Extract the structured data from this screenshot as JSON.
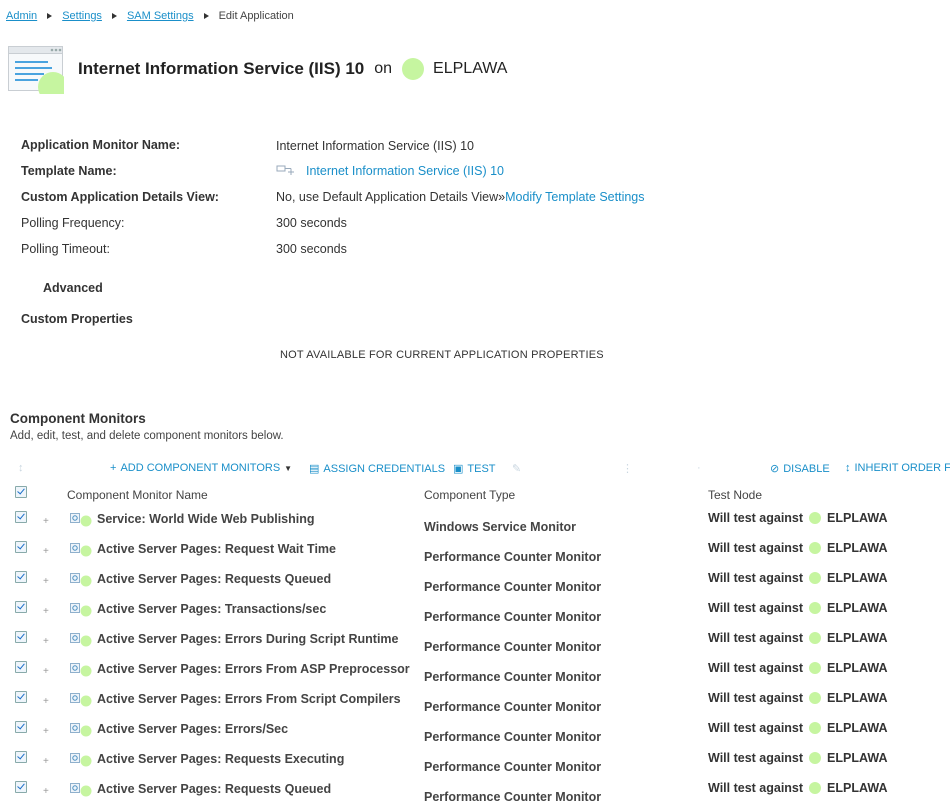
{
  "breadcrumb": {
    "items": [
      "Admin",
      "Settings",
      "SAM Settings"
    ],
    "current": "Edit Application"
  },
  "header": {
    "title": "Internet Information Service (IIS) 10",
    "on": "on",
    "node": "ELPLAWA"
  },
  "properties": {
    "monitor_name_label": "Application Monitor Name:",
    "monitor_name_value": "Internet Information Service (IIS) 10",
    "template_label": "Template Name:",
    "template_value": "Internet Information Service (IIS) 10",
    "details_label": "Custom Application Details View:",
    "details_value": "No, use Default Application Details View»",
    "details_link": "Modify Template Settings",
    "polling_freq_label": "Polling Frequency:",
    "polling_freq_value": "300 seconds",
    "polling_timeout_label": "Polling Timeout:",
    "polling_timeout_value": "300 seconds",
    "advanced_label": "Advanced",
    "custom_props_label": "Custom Properties",
    "not_available": "NOT AVAILABLE FOR CURRENT APPLICATION PROPERTIES"
  },
  "components": {
    "title": "Component Monitors",
    "subtitle": "Add, edit, test, and delete component monitors below.",
    "toolbar": {
      "add": "ADD COMPONENT MONITORS",
      "assign": "ASSIGN CREDENTIALS",
      "test": "TEST",
      "disable": "DISABLE",
      "inherit": "INHERIT ORDER F"
    },
    "columns": {
      "name": "Component Monitor Name",
      "type": "Component Type",
      "test": "Test Node"
    },
    "rows": [
      {
        "name": "Service: World Wide Web Publishing",
        "type": "Windows Service Monitor",
        "test": "Will test against",
        "node": "ELPLAWA"
      },
      {
        "name": "Active Server Pages: Request Wait Time",
        "type": "Performance Counter Monitor",
        "test": "Will test against",
        "node": "ELPLAWA"
      },
      {
        "name": "Active Server Pages: Requests Queued",
        "type": "Performance Counter Monitor",
        "test": "Will test against",
        "node": "ELPLAWA"
      },
      {
        "name": "Active Server Pages: Transactions/sec",
        "type": "Performance Counter Monitor",
        "test": "Will test against",
        "node": "ELPLAWA"
      },
      {
        "name": "Active Server Pages: Errors During Script Runtime",
        "type": "Performance Counter Monitor",
        "test": "Will test against",
        "node": "ELPLAWA"
      },
      {
        "name": "Active Server Pages: Errors From ASP Preprocessor",
        "type": "Performance Counter Monitor",
        "test": "Will test against",
        "node": "ELPLAWA"
      },
      {
        "name": "Active Server Pages: Errors From Script Compilers",
        "type": "Performance Counter Monitor",
        "test": "Will test against",
        "node": "ELPLAWA"
      },
      {
        "name": "Active Server Pages: Errors/Sec",
        "type": "Performance Counter Monitor",
        "test": "Will test against",
        "node": "ELPLAWA"
      },
      {
        "name": "Active Server Pages: Requests Executing",
        "type": "Performance Counter Monitor",
        "test": "Will test against",
        "node": "ELPLAWA"
      },
      {
        "name": "Active Server Pages: Requests Queued",
        "type": "Performance Counter Monitor",
        "test": "Will test against",
        "node": "ELPLAWA"
      }
    ]
  },
  "colors": {
    "link": "#1a8fc9",
    "status_up": "#c6f5a0"
  }
}
